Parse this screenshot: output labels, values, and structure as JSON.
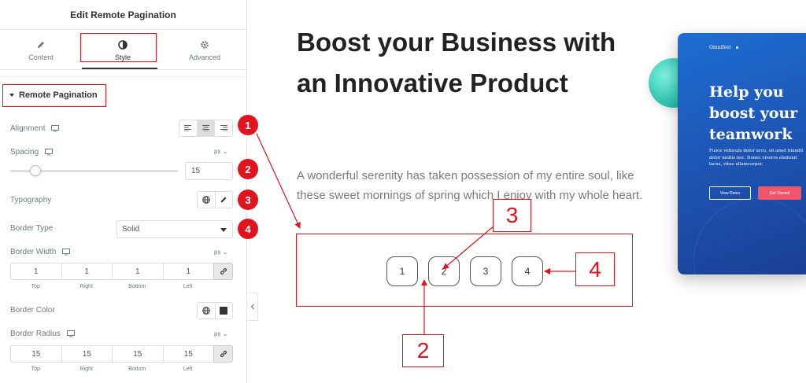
{
  "panel": {
    "title": "Edit Remote Pagination",
    "tabs": [
      {
        "label": "Content",
        "icon": "pencil-icon"
      },
      {
        "label": "Style",
        "icon": "half-circle-icon"
      },
      {
        "label": "Advanced",
        "icon": "gear-icon"
      }
    ],
    "section": "Remote Pagination",
    "alignment_label": "Alignment",
    "spacing_label": "Spacing",
    "spacing_unit": "px",
    "spacing_value": "15",
    "typography_label": "Typography",
    "border_type_label": "Border Type",
    "border_type_value": "Solid",
    "border_width_label": "Border Width",
    "border_width_unit": "px",
    "border_width_values": [
      "1",
      "1",
      "1",
      "1"
    ],
    "dim_labels": [
      "Top",
      "Right",
      "Bottom",
      "Left"
    ],
    "border_color_label": "Border Color",
    "border_radius_label": "Border Radius",
    "border_radius_unit": "px",
    "border_radius_values": [
      "15",
      "15",
      "15",
      "15"
    ]
  },
  "preview": {
    "headline": "Boost your Business with an Innovative Product",
    "paragraph": "A wonderful serenity has taken possession of my entire soul, like these sweet mornings of spring which I enjoy with my whole heart.",
    "pages": [
      "1",
      "2",
      "3",
      "4"
    ]
  },
  "card": {
    "brand": "Omnifest",
    "heading": "Help you boost your teamwork",
    "text": "Fusce vehicula dolor arcu, sit amet blandit dolor mollis nec. Donec viverra eleifend lacus, vitae ullamcorper.",
    "btn1": "View Rates",
    "btn2": "Get Started"
  },
  "annotations": {
    "badges": [
      "1",
      "2",
      "3",
      "4"
    ],
    "callouts": [
      "3",
      "4",
      "2"
    ]
  },
  "colors": {
    "accent": "#e0141c",
    "card": "#1d55b4"
  }
}
